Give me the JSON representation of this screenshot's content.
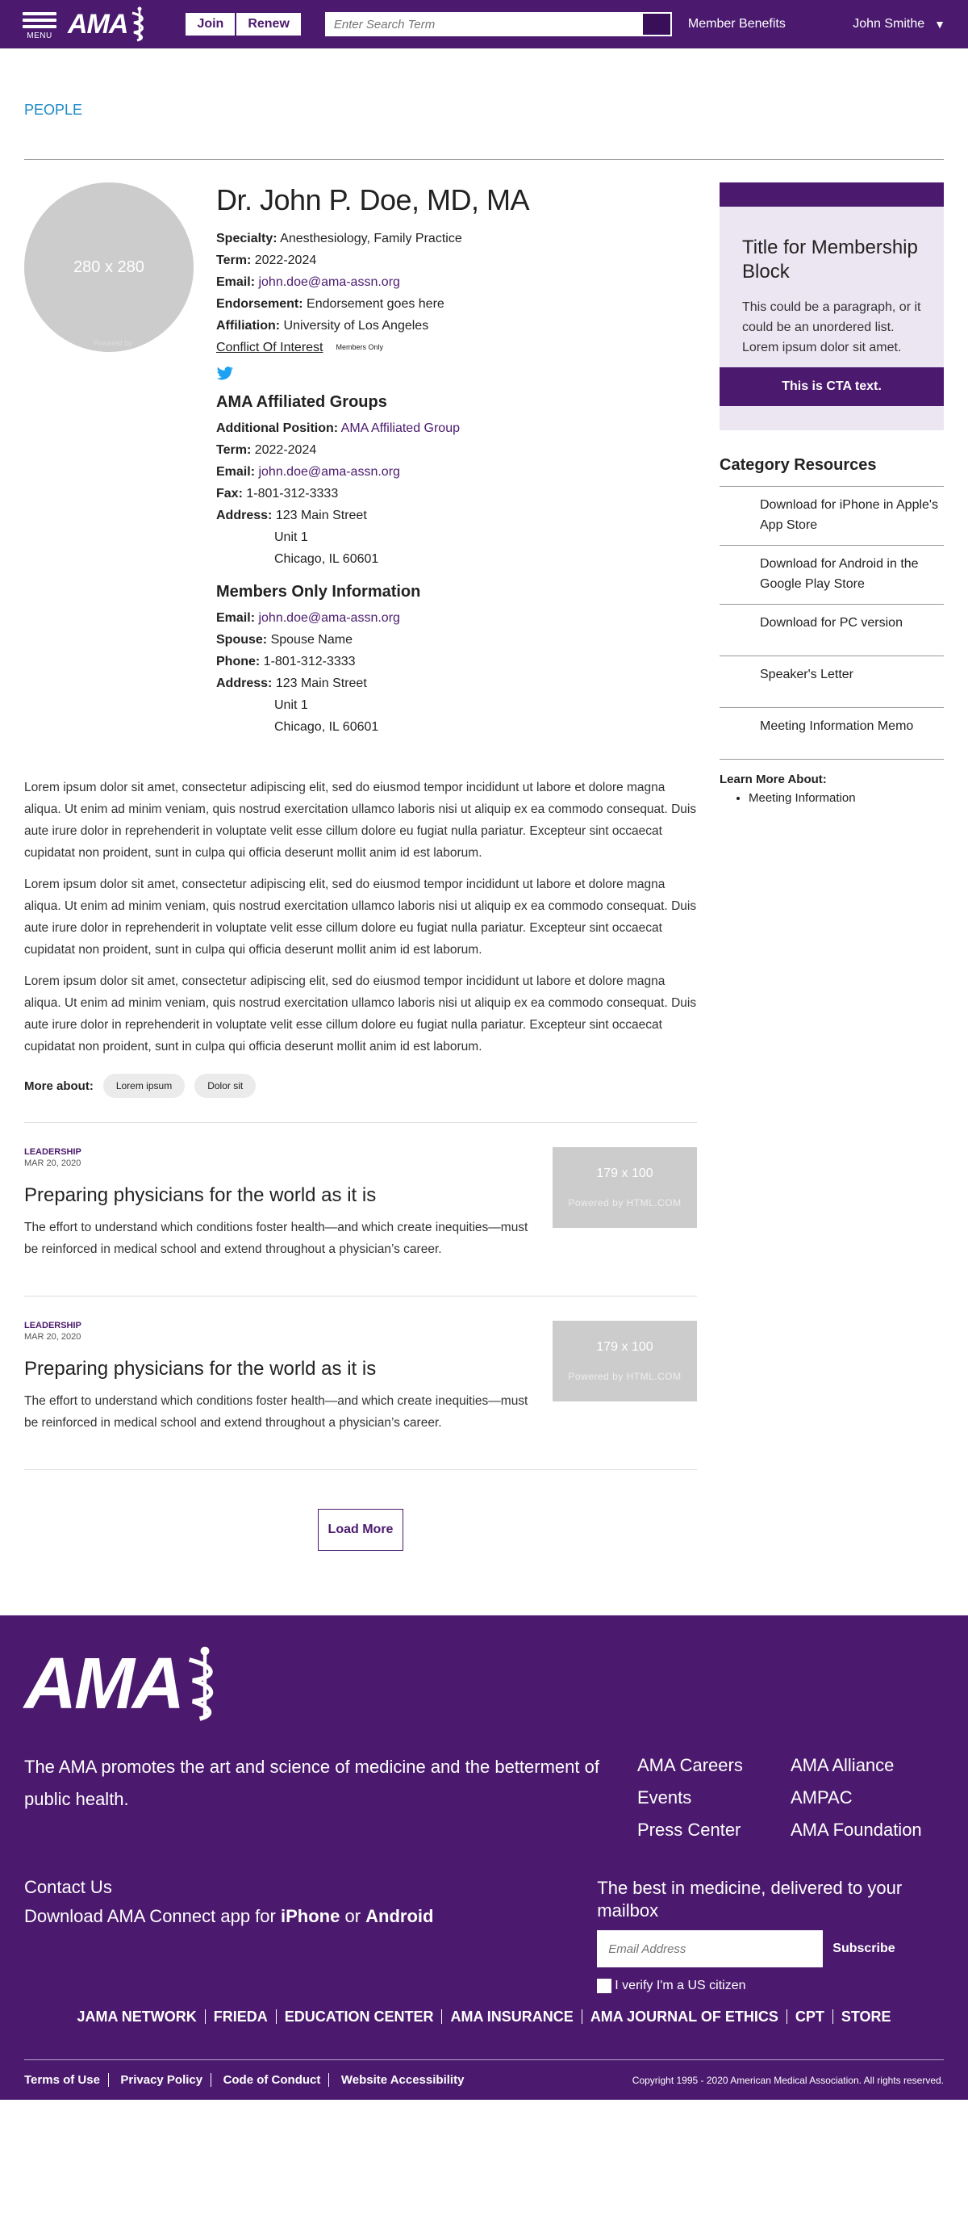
{
  "header": {
    "menu_label": "MENU",
    "logo_text": "AMA",
    "join_label": "Join",
    "renew_label": "Renew",
    "search_placeholder": "Enter Search Term",
    "member_benefits": "Member Benefits",
    "user_name": "John Smithe"
  },
  "breadcrumb": "PEOPLE",
  "profile": {
    "avatar_text": "280 x 280",
    "avatar_watermark": "Powered by",
    "name": "Dr. John P. Doe, MD, MA",
    "fields": {
      "specialty_label": "Specialty:",
      "specialty": "Anesthesiology, Family Practice",
      "term_label": "Term:",
      "term": "2022-2024",
      "email_label": "Email:",
      "email": "john.doe@ama-assn.org",
      "endorsement_label": "Endorsement:",
      "endorsement": "Endorsement goes here",
      "affiliation_label": "Affiliation:",
      "affiliation": "University of Los Angeles"
    },
    "conflict_link": "Conflict Of Interest",
    "members_only_tag": "Members Only",
    "affiliated": {
      "heading": "AMA Affiliated Groups",
      "position_label": "Additional Position:",
      "position": "AMA Affiliated Group",
      "term_label": "Term:",
      "term": "2022-2024",
      "email_label": "Email:",
      "email": "john.doe@ama-assn.org",
      "fax_label": "Fax:",
      "fax": "1-801-312-3333",
      "address_label": "Address:",
      "address_1": "123 Main Street",
      "address_2": "Unit 1",
      "address_3": "Chicago, IL 60601"
    },
    "members_only": {
      "heading": "Members Only Information",
      "email_label": "Email:",
      "email": "john.doe@ama-assn.org",
      "spouse_label": "Spouse:",
      "spouse": "Spouse Name",
      "phone_label": "Phone:",
      "phone": "1-801-312-3333",
      "address_label": "Address:",
      "address_1": "123 Main Street",
      "address_2": "Unit 1",
      "address_3": "Chicago, IL 60601"
    }
  },
  "body_paragraphs": [
    "Lorem ipsum dolor sit amet, consectetur adipiscing elit, sed do eiusmod tempor incididunt ut labore et dolore magna aliqua. Ut enim ad minim veniam, quis nostrud exercitation ullamco laboris nisi ut aliquip ex ea commodo consequat. Duis aute irure dolor in reprehenderit in voluptate velit esse cillum dolore eu fugiat nulla pariatur. Excepteur sint occaecat cupidatat non proident, sunt in culpa qui officia deserunt mollit anim id est laborum.",
    "Lorem ipsum dolor sit amet, consectetur adipiscing elit, sed do eiusmod tempor incididunt ut labore et dolore magna aliqua. Ut enim ad minim veniam, quis nostrud exercitation ullamco laboris nisi ut aliquip ex ea commodo consequat. Duis aute irure dolor in reprehenderit in voluptate velit esse cillum dolore eu fugiat nulla pariatur. Excepteur sint occaecat cupidatat non proident, sunt in culpa qui officia deserunt mollit anim id est laborum.",
    "Lorem ipsum dolor sit amet, consectetur adipiscing elit, sed do eiusmod tempor incididunt ut labore et dolore magna aliqua. Ut enim ad minim veniam, quis nostrud exercitation ullamco laboris nisi ut aliquip ex ea commodo consequat. Duis aute irure dolor in reprehenderit in voluptate velit esse cillum dolore eu fugiat nulla pariatur. Excepteur sint occaecat cupidatat non proident, sunt in culpa qui officia deserunt mollit anim id est laborum."
  ],
  "more_about": {
    "label": "More about:",
    "tags": [
      "Lorem ipsum",
      "Dolor sit"
    ]
  },
  "articles": [
    {
      "category": "LEADERSHIP",
      "date": "MAR 20, 2020",
      "title": "Preparing physicians for the world as it is",
      "summary": "The effort to understand which conditions foster health—and which create inequities—must be reinforced in medical school and extend throughout a physician’s career.",
      "thumb_text": "179 x 100",
      "thumb_watermark": "Powered by HTML.COM"
    },
    {
      "category": "LEADERSHIP",
      "date": "MAR 20, 2020",
      "title": "Preparing physicians for the world as it is",
      "summary": "The effort to understand which conditions foster health—and which create inequities—must be reinforced in medical school and extend throughout a physician’s career.",
      "thumb_text": "179 x 100",
      "thumb_watermark": "Powered by HTML.COM"
    }
  ],
  "load_more": "Load More",
  "sidebar": {
    "membership": {
      "title": "Title for Membership Block",
      "text": "This could be a paragraph, or it could be an unordered list. Lorem ipsum dolor sit amet.",
      "cta": "This is CTA text."
    },
    "resources_title": "Category Resources",
    "resources": [
      "Download for iPhone in Apple's App Store",
      "Download for Android in the Google Play Store",
      "Download for PC version",
      "Speaker's Letter",
      "Meeting Information Memo"
    ],
    "learn_more_label": "Learn More About:",
    "learn_more_items": [
      "Meeting Information"
    ]
  },
  "footer": {
    "logo_text": "AMA",
    "mission": "The AMA promotes the art and science of medicine and the betterment of public health.",
    "links": [
      "AMA Careers",
      "AMA Alliance",
      "Events",
      "AMPAC",
      "Press Center",
      "AMA Foundation"
    ],
    "contact_heading": "Contact Us",
    "app_prefix": "Download AMA Connect app for",
    "app_iphone": "iPhone",
    "app_or": "or",
    "app_android": "Android",
    "newsletter_heading": "The best in medicine, delivered to your mailbox",
    "email_placeholder": "Email Address",
    "subscribe": "Subscribe",
    "verify": "I verify I'm a US citizen",
    "nav": [
      "JAMA NETWORK",
      "FRIEDA",
      "EDUCATION CENTER",
      "AMA INSURANCE",
      "AMA JOURNAL OF ETHICS",
      "CPT",
      "STORE"
    ],
    "legal": [
      "Terms of Use",
      "Privacy Policy",
      "Code of Conduct",
      "Website Accessibility"
    ],
    "copyright": "Copyright 1995 - 2020 American Medical Association. All rights reserved."
  },
  "colors": {
    "brand_purple": "#4b1a6e",
    "link_blue": "#1a89c9",
    "light_purple": "#ece6f2"
  }
}
